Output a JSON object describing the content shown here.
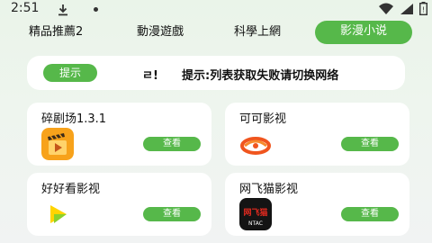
{
  "status_bar": {
    "time": "2:51",
    "icons": [
      "download-icon",
      "dot-icon",
      "wifi-icon",
      "signal-icon",
      "battery-icon"
    ]
  },
  "tabs": [
    {
      "label": "精品推薦2",
      "active": false
    },
    {
      "label": "動漫遊戲",
      "active": false
    },
    {
      "label": "科學上網",
      "active": false
    },
    {
      "label": "影漫小说",
      "active": true
    }
  ],
  "notice": {
    "button_label": "提示",
    "scroll_fragment": "ㄹ!",
    "text": "提示:列表获取失败请切换网络"
  },
  "cards": [
    {
      "title": "碎剧场1.3.1",
      "button_label": "查看",
      "icon": "film-clapper-icon"
    },
    {
      "title": "可可影视",
      "button_label": "查看",
      "icon": "orange-wave-icon"
    },
    {
      "title": "好好看影视",
      "button_label": "查看",
      "icon": "yellow-green-play-icon"
    },
    {
      "title": "网飞猫影视",
      "button_label": "查看",
      "icon": "netcat-logo-icon",
      "logo_text": "网飞猫",
      "logo_subtext": "NTAC"
    }
  ],
  "colors": {
    "accent": "#56b84a",
    "background": "#eaf4e9",
    "card": "#ffffff"
  }
}
